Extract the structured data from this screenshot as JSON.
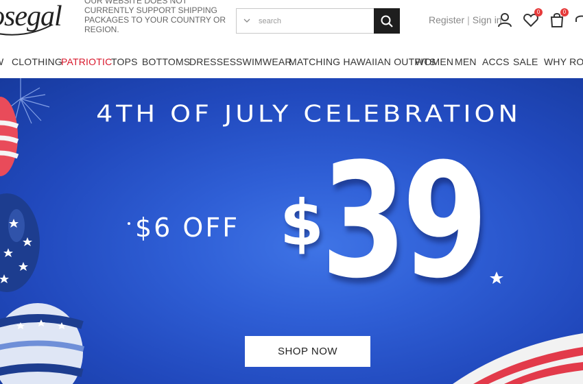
{
  "header": {
    "logo": "osegal",
    "notice": "OUR WEBSITE DOES NOT CURRENTLY SUPPORT SHIPPING PACKAGES TO YOUR COUNTRY OR REGION.",
    "search": {
      "placeholder": "search"
    },
    "register_label": "Register",
    "separator": "|",
    "signin_label": "Sign in",
    "wishlist_count": "0",
    "cart_count": "0"
  },
  "nav": {
    "items": [
      {
        "label": "W"
      },
      {
        "label": "CLOTHING"
      },
      {
        "label": "PATRIOTIC"
      },
      {
        "label": "TOPS"
      },
      {
        "label": "BOTTOMS"
      },
      {
        "label": "DRESSES"
      },
      {
        "label": "SWIMWEAR"
      },
      {
        "label": "MATCHING HAWAIIAN OUTFITS"
      },
      {
        "label": "WOMEN"
      },
      {
        "label": "MEN"
      },
      {
        "label": "ACCS"
      },
      {
        "label": "SALE"
      },
      {
        "label": "WHY ROSE"
      }
    ]
  },
  "banner": {
    "title": "4TH OF JULY CELEBRATION",
    "offer": "$6 OFF",
    "currency": "$",
    "price": "39",
    "button_label": "SHOP NOW"
  },
  "colors": {
    "accent": "#d8172b",
    "banner_blue": "#2f5fd6",
    "badge": "#e63b3b"
  }
}
